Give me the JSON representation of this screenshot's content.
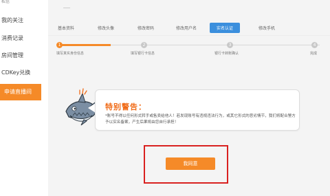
{
  "sidebar": {
    "top_partial": "私信",
    "items": [
      {
        "label": "我的关注",
        "active": false
      },
      {
        "label": "消费记录",
        "active": false
      },
      {
        "label": "房间管理",
        "active": false
      },
      {
        "label": "CDKey兑换",
        "active": false
      },
      {
        "label": "申请直播间",
        "active": true
      }
    ]
  },
  "tabs": [
    "基本资料",
    "修改头像",
    "修改密码",
    "修改用户名",
    "实名认证",
    "修改手机"
  ],
  "active_tab": "实名认证",
  "steps": [
    {
      "num": "1",
      "label": "填写真实身份信息",
      "done": true
    },
    {
      "num": "2",
      "label": "填写银行卡信息",
      "done": false
    },
    {
      "num": "3",
      "label": "银行卡转账确认",
      "done": false
    },
    {
      "num": "4",
      "label": "完成",
      "done": false
    }
  ],
  "progress_fraction": 0.2,
  "warning": {
    "title": "特别警告：",
    "text": "*账号不得以任何形式转手或售卖给他人！若发现账号有违规违法行为，或其它形式的恶劣情节，我们将配合警方予以实名备案，产生后果将由您自行承担！"
  },
  "confirm_button": "我同意",
  "colors": {
    "accent": "#f58a28",
    "tab_active": "#3b8fdd",
    "warning_title": "#f06a16",
    "highlight": "#d9201f"
  }
}
